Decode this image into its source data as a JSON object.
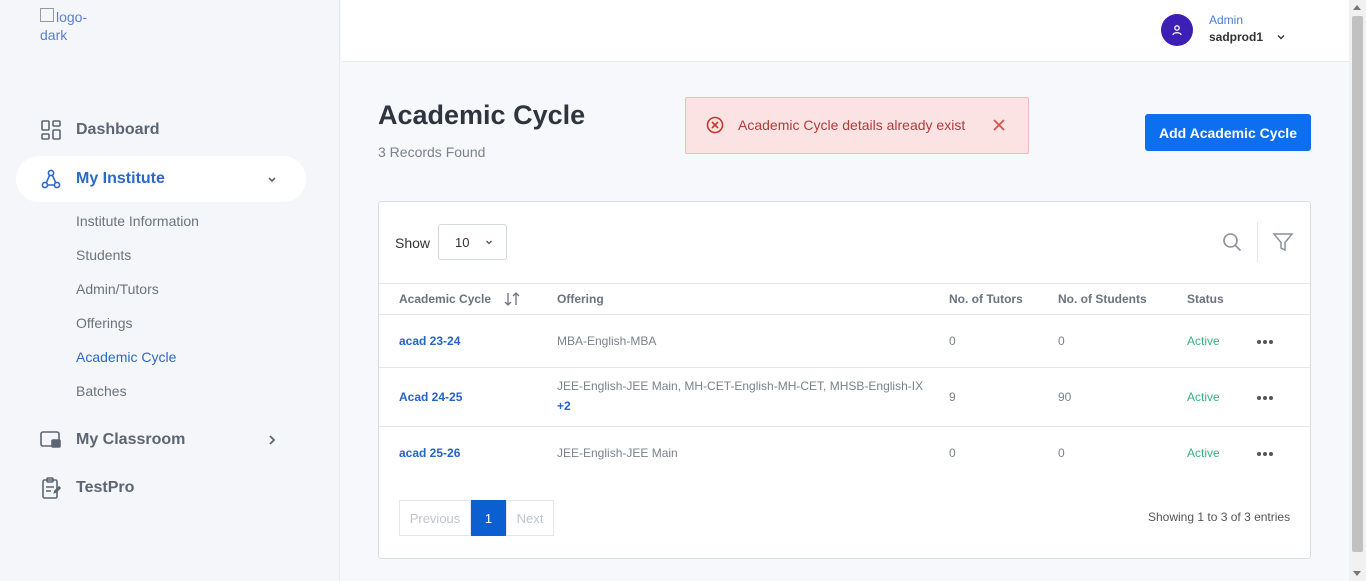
{
  "logo": {
    "alt": "logo-dark"
  },
  "sidebar": {
    "items": [
      {
        "label": "Dashboard"
      },
      {
        "label": "My Institute"
      },
      {
        "label": "My Classroom"
      },
      {
        "label": "TestPro"
      }
    ],
    "sub_items": [
      {
        "label": "Institute Information"
      },
      {
        "label": "Students"
      },
      {
        "label": "Admin/Tutors"
      },
      {
        "label": "Offerings"
      },
      {
        "label": "Academic Cycle"
      },
      {
        "label": "Batches"
      }
    ]
  },
  "header": {
    "user_role": "Admin",
    "user_name": "sadprod1"
  },
  "page": {
    "title": "Academic Cycle",
    "records": "3 Records Found",
    "add_button": "Add Academic Cycle"
  },
  "alert": {
    "message": "Academic Cycle details already exist"
  },
  "table": {
    "show_label": "Show",
    "page_size": "10",
    "columns": [
      "Academic Cycle",
      "Offering",
      "No. of Tutors",
      "No. of Students",
      "Status"
    ],
    "rows": [
      {
        "cycle": "acad 23-24",
        "offering": "MBA-English-MBA",
        "more": "",
        "tutors": "0",
        "students": "0",
        "status": "Active"
      },
      {
        "cycle": "Acad 24-25",
        "offering": "JEE-English-JEE Main, MH-CET-English-MH-CET, MHSB-English-IX",
        "more": "+2",
        "tutors": "9",
        "students": "90",
        "status": "Active"
      },
      {
        "cycle": "acad 25-26",
        "offering": "JEE-English-JEE Main",
        "more": "",
        "tutors": "0",
        "students": "0",
        "status": "Active"
      }
    ],
    "pagination": {
      "previous": "Previous",
      "page": "1",
      "next": "Next"
    },
    "entries_text": "Showing 1 to 3 of 3 entries"
  },
  "colors": {
    "primary": "#0b6ff0",
    "link": "#2563c9",
    "status_active": "#36b37e",
    "alert_bg": "#fbe3e3",
    "alert_text": "#b23b3b",
    "avatar": "#3d1fb5"
  }
}
